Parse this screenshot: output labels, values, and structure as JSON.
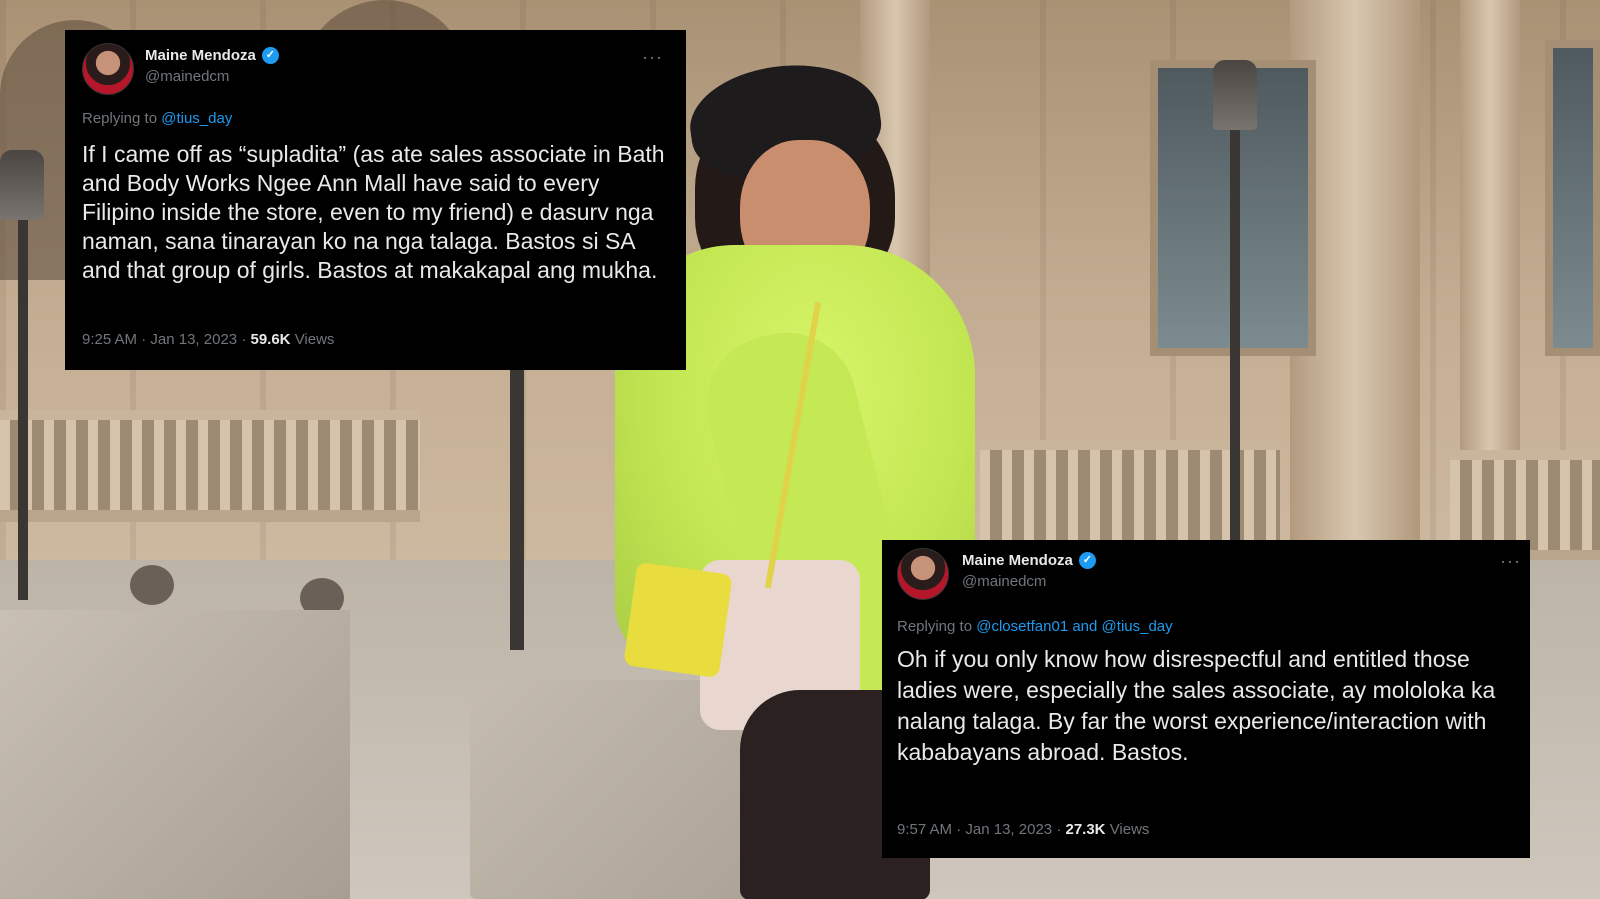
{
  "tweets": [
    {
      "author_name": "Maine Mendoza",
      "author_handle": "@mainedcm",
      "replying_prefix": "Replying to",
      "mentions": [
        "@tius_day"
      ],
      "mention_joiner": "",
      "text": "If I came off as “supladita” (as ate sales associate in Bath and Body Works Ngee Ann Mall have said to every Filipino inside the store, even to my friend) e dasurv nga naman, sana tinarayan ko na nga talaga. Bastos si SA and that group of girls. Bastos at makakapal ang mukha.",
      "time": "9:25 AM",
      "date": "Jan 13, 2023",
      "views_count": "59.6K",
      "views_label": "Views",
      "more_icon": "more-icon",
      "verified_icon": "verified-badge-icon",
      "sep": "·"
    },
    {
      "author_name": "Maine Mendoza",
      "author_handle": "@mainedcm",
      "replying_prefix": "Replying to",
      "mentions": [
        "@closetfan01",
        "@tius_day"
      ],
      "mention_joiner": "and",
      "text": "Oh if you only know how disrespectful and entitled those ladies were, especially the sales associate, ay mololoka ka nalang talaga. By far the worst experience/interaction with kababayans abroad. Bastos.",
      "time": "9:57 AM",
      "date": "Jan 13, 2023",
      "views_count": "27.3K",
      "views_label": "Views",
      "more_icon": "more-icon",
      "verified_icon": "verified-badge-icon",
      "sep": "·"
    }
  ],
  "colors": {
    "card_bg": "#000000",
    "text_primary": "#e7e9ea",
    "text_secondary": "#71767b",
    "link": "#1d9bf0",
    "verified": "#1d9bf0"
  }
}
